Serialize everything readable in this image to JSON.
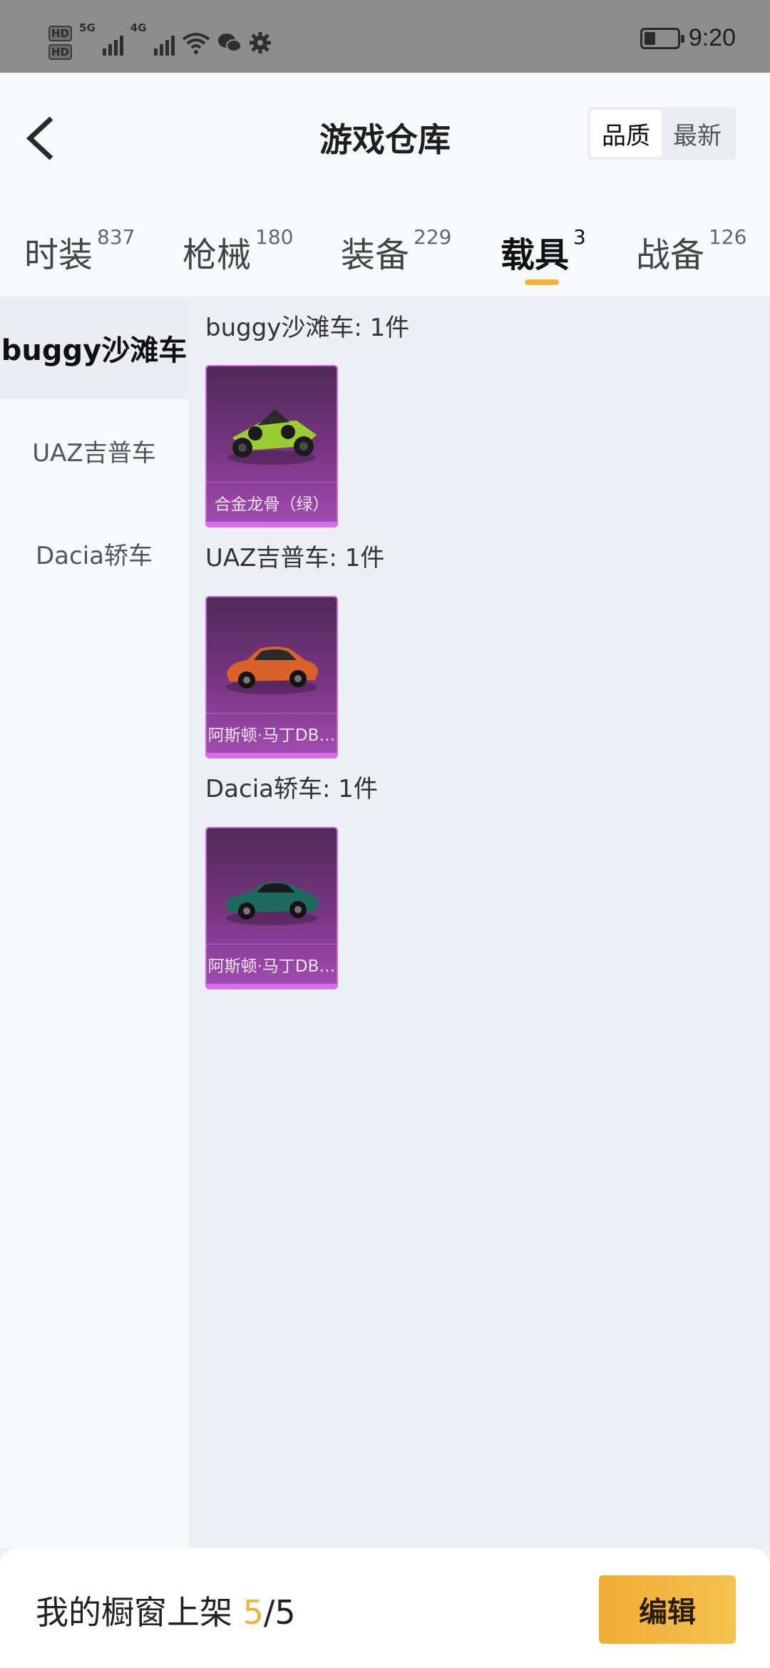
{
  "status_bar": {
    "time": "9:20",
    "battery_level": 0.35,
    "network": [
      "5G",
      "4G"
    ]
  },
  "header": {
    "title": "游戏仓库",
    "sort_options": [
      "品质",
      "最新"
    ],
    "sort_selected": "品质"
  },
  "tabs": [
    {
      "label": "时装",
      "count": "837"
    },
    {
      "label": "枪械",
      "count": "180"
    },
    {
      "label": "装备",
      "count": "229"
    },
    {
      "label": "载具",
      "count": "3",
      "active": true
    },
    {
      "label": "战备",
      "count": "126"
    }
  ],
  "sidebar": {
    "items": [
      {
        "label": "buggy沙滩车",
        "active": true
      },
      {
        "label": "UAZ吉普车"
      },
      {
        "label": "Dacia轿车"
      }
    ]
  },
  "groups": [
    {
      "title": "buggy沙滩车: 1件",
      "items": [
        {
          "name": "合金龙骨（绿）",
          "color": "#9acd32"
        }
      ]
    },
    {
      "title": "UAZ吉普车: 1件",
      "items": [
        {
          "name": "阿斯顿·马丁DB…",
          "color": "#d9622b"
        }
      ]
    },
    {
      "title": "Dacia轿车: 1件",
      "items": [
        {
          "name": "阿斯顿·马丁DB…",
          "color": "#1f6a5e"
        }
      ]
    }
  ],
  "footer": {
    "label_prefix": "我的橱窗上架 ",
    "listed": "5",
    "separator": "/",
    "total": "5",
    "edit_label": "编辑"
  }
}
